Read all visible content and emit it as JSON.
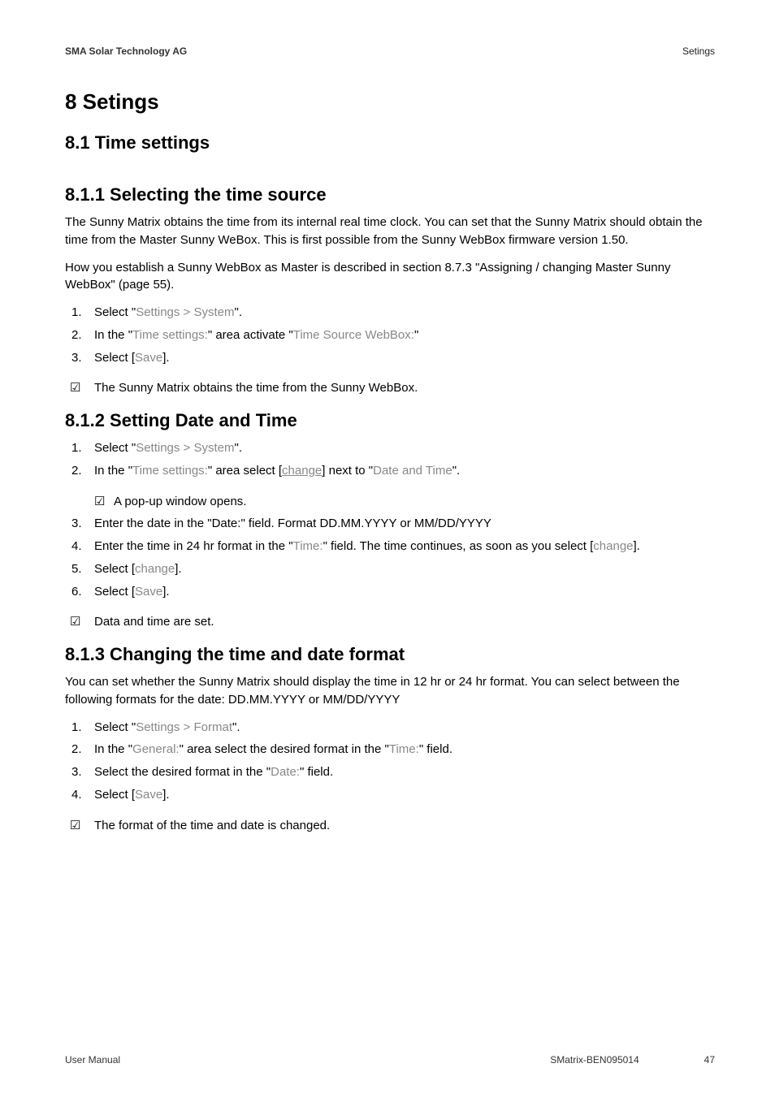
{
  "header": {
    "companyName": "SMA Solar Technology AG",
    "sectionName": "Setings"
  },
  "h1": "8  Setings",
  "s8_1": {
    "title": "8.1 Time settings"
  },
  "s8_1_1": {
    "title": "8.1.1  Selecting the time source",
    "p1": "The Sunny Matrix obtains the time from its internal real time clock. You can set that the Sunny Matrix should obtain the time from the Master Sunny WeBox. This is first possible from the Sunny WebBox firmware version 1.50.",
    "p2": "How you establish a Sunny WebBox as Master is described in section 8.7.3 \"Assigning / changing Master Sunny WebBox\" (page 55).",
    "steps": {
      "1": {
        "n": "1.",
        "a": " Select \"",
        "ui": "Settings > System",
        "c": "\"."
      },
      "2": {
        "n": "2.",
        "a": "In the \"",
        "ui1": "Time settings:",
        "b": "\" area activate \"",
        "ui2": "Time Source WebBox:",
        "c": "\""
      },
      "3": {
        "n": "3.",
        "a": "Select [",
        "ui": "Save",
        "c": "]."
      }
    },
    "result": "The Sunny Matrix obtains the time from the Sunny WebBox."
  },
  "s8_1_2": {
    "title": "8.1.2  Setting Date and Time",
    "steps": {
      "1": {
        "n": "1.",
        "a": " Select \"",
        "ui": "Settings > System",
        "c": "\"."
      },
      "2": {
        "n": "2.",
        "a": "In the \"",
        "ui1": "Time settings:",
        "b": "\" area select [",
        "uilink": "change",
        "c": "] next to \"",
        "ui2": "Date and Time",
        "d": "\"."
      },
      "sub": "A pop-up window opens.",
      "3": {
        "n": "3.",
        "t": "Enter the date in the \"Date:\" field. Format DD.MM.YYYY or MM/DD/YYYY"
      },
      "4": {
        "n": "4.",
        "a": "Enter the time in 24 hr format in the \"",
        "ui1": "Time:",
        "b": "\" field. The time continues, as soon as you select [",
        "ui2": "change",
        "c": "]."
      },
      "5": {
        "n": "5.",
        "a": "Select [",
        "ui": "change",
        "c": "]."
      },
      "6": {
        "n": "6.",
        "a": "Select [",
        "ui": "Save",
        "c": "]."
      }
    },
    "result": "Data and time are set."
  },
  "s8_1_3": {
    "title": "8.1.3  Changing the time and date format",
    "p1": "You can set whether the Sunny Matrix should display the time in 12 hr or 24 hr format. You can select between the following formats for the date: DD.MM.YYYY or MM/DD/YYYY",
    "steps": {
      "1": {
        "n": "1.",
        "a": "Select \"",
        "ui": "Settings > Format",
        "c": "\"."
      },
      "2": {
        "n": "2.",
        "a": "In the \"",
        "ui1": "General:",
        "b": "\" area select the desired format in the \"",
        "ui2": "Time:",
        "c": "\" field."
      },
      "3": {
        "n": "3.",
        "a": "Select the desired format in the \"",
        "ui": "Date:",
        "c": "\" field."
      },
      "4": {
        "n": "4.",
        "a": "Select [",
        "ui": "Save",
        "c": "]."
      }
    },
    "result": "The format of the time and date is changed."
  },
  "footer": {
    "left": "User Manual",
    "code": "SMatrix-BEN095014",
    "page": "47"
  },
  "glyph": {
    "check": "☑"
  }
}
